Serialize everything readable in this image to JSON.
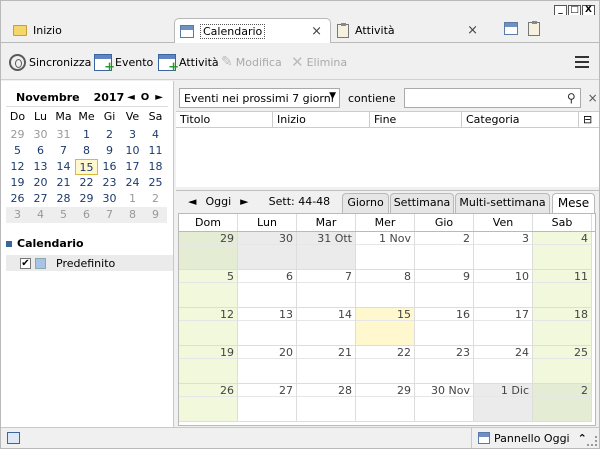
{
  "window": {
    "min": "_",
    "max": "□",
    "close": "X"
  },
  "tabs": [
    {
      "label": "Inizio"
    },
    {
      "label": "Calendario",
      "close": "×"
    },
    {
      "label": "Attività",
      "close": "×"
    }
  ],
  "toolbar": {
    "sync": "Sincronizza",
    "event": "Evento",
    "task": "Attività",
    "edit": "Modifica",
    "delete": "Elimina"
  },
  "minical": {
    "month": "Novembre",
    "year": "2017",
    "prev": "◄",
    "today": "O",
    "next": "►",
    "weekdays": [
      "Do",
      "Lu",
      "Ma",
      "Me",
      "Gi",
      "Ve",
      "Sa"
    ],
    "days": [
      "29",
      "30",
      "31",
      "1",
      "2",
      "3",
      "4",
      "5",
      "6",
      "7",
      "8",
      "9",
      "10",
      "11",
      "12",
      "13",
      "14",
      "15",
      "16",
      "17",
      "18",
      "19",
      "20",
      "21",
      "22",
      "23",
      "24",
      "25",
      "26",
      "27",
      "28",
      "29",
      "30",
      "1",
      "2",
      "3",
      "4",
      "5",
      "6",
      "7",
      "8",
      "9"
    ]
  },
  "calendars": {
    "title": "Calendario",
    "items": [
      {
        "name": "Predefinito",
        "checked": "✔"
      }
    ]
  },
  "filter": {
    "select": "Eventi nei prossimi 7 giorni",
    "contains": "contiene",
    "search": "",
    "clear": "×"
  },
  "eventlist": {
    "columns": [
      "Titolo",
      "Inizio",
      "Fine",
      "Categoria"
    ]
  },
  "viewbar": {
    "prev": "◄",
    "today": "Oggi",
    "next": "►",
    "week": "Sett: 44-48",
    "views": [
      "Giorno",
      "Settimana",
      "Multi-settimana",
      "Mese"
    ]
  },
  "month": {
    "weekdays": [
      "Dom",
      "Lun",
      "Mar",
      "Mer",
      "Gio",
      "Ven",
      "Sab"
    ],
    "cells": [
      "29",
      "30",
      "31 Ott",
      "1 Nov",
      "2",
      "3",
      "4",
      "5",
      "6",
      "7",
      "8",
      "9",
      "10",
      "11",
      "12",
      "13",
      "14",
      "15",
      "16",
      "17",
      "18",
      "19",
      "20",
      "21",
      "22",
      "23",
      "24",
      "25",
      "26",
      "27",
      "28",
      "29",
      "30 Nov",
      "1 Dic",
      "2"
    ]
  },
  "status": {
    "panel": "Pannello Oggi",
    "arrow": "⌃"
  }
}
